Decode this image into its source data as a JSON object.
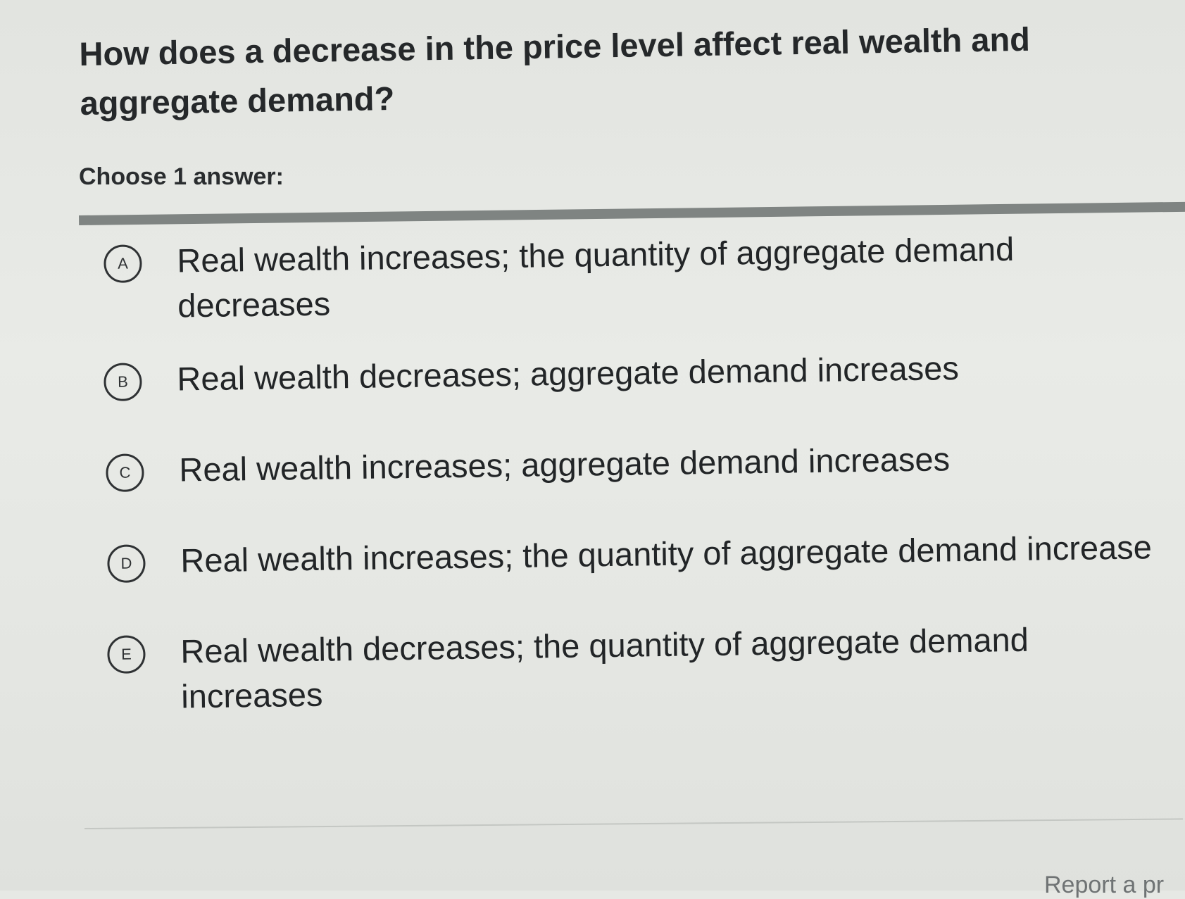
{
  "question": {
    "text": "How does a decrease in the price level affect real wealth and aggregate demand?",
    "prompt": "Choose 1 answer:"
  },
  "options": [
    {
      "letter": "A",
      "text": "Real wealth increases; the quantity of aggregate demand decreases"
    },
    {
      "letter": "B",
      "text": "Real wealth decreases; aggregate demand increases"
    },
    {
      "letter": "C",
      "text": "Real wealth increases; aggregate demand increases"
    },
    {
      "letter": "D",
      "text": "Real wealth increases; the quantity of aggregate demand increase"
    },
    {
      "letter": "E",
      "text": "Real wealth decreases; the quantity of aggregate demand increases"
    }
  ],
  "footer": {
    "report_label": "Report a pr"
  }
}
